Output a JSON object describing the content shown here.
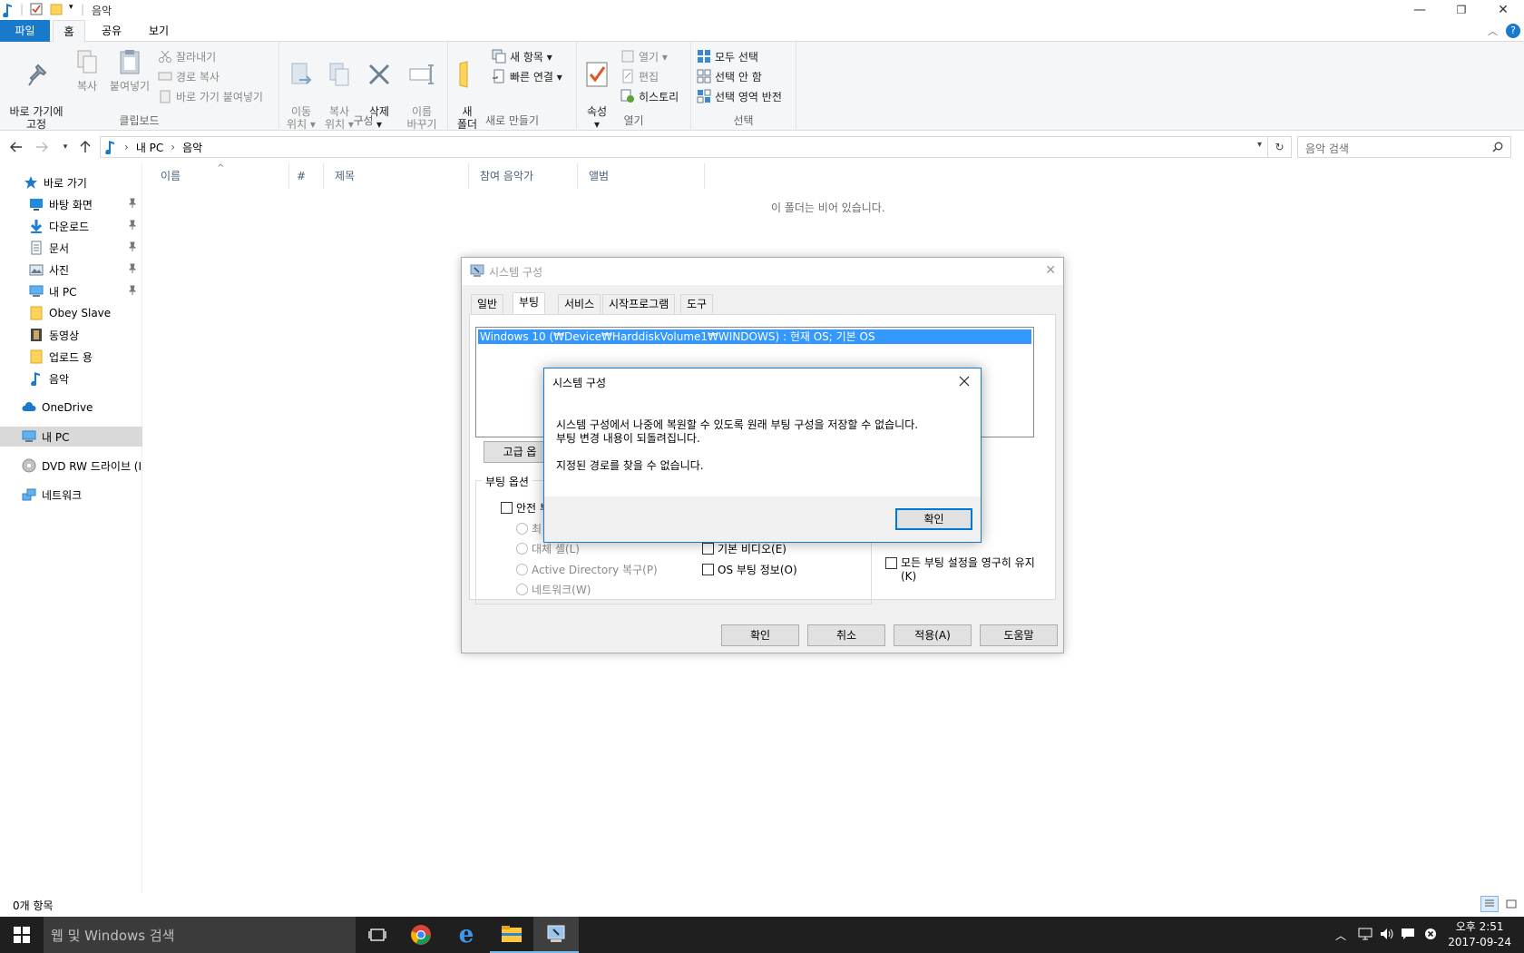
{
  "window": {
    "title": "음악",
    "minimize_glyph": "—",
    "restore_glyph": "❐",
    "close_glyph": "✕"
  },
  "ribbon_tabs": [
    "파일",
    "홈",
    "공유",
    "보기"
  ],
  "ribbon": {
    "clipboard": {
      "label": "클립보드",
      "pin": "바로 가기에\n고정",
      "copy": "복사",
      "paste": "붙여넣기",
      "cut": "잘라내기",
      "copy_path": "경로 복사",
      "paste_shortcut": "바로 가기 붙여넣기"
    },
    "organize": {
      "label": "구성",
      "move": "이동\n위치 ▾",
      "copyto": "복사\n위치 ▾",
      "delete": "삭제\n▾",
      "rename": "이름\n바꾸기"
    },
    "new": {
      "label": "새로 만들기",
      "new_folder": "새\n폴더",
      "new_item": "새 항목 ▾",
      "easy_access": "빠른 연결 ▾"
    },
    "open": {
      "label": "열기",
      "properties": "속성\n▾",
      "open": "열기 ▾",
      "edit": "편집",
      "history": "히스토리"
    },
    "select": {
      "label": "선택",
      "select_all": "모두 선택",
      "select_none": "선택 안 함",
      "invert": "선택 영역 반전"
    }
  },
  "address": {
    "crumbs": [
      "내 PC",
      "음악"
    ],
    "search_placeholder": "음악 검색"
  },
  "sidebar": {
    "quick_access": "바로 가기",
    "items": [
      {
        "label": "바탕 화면",
        "icon": "desktop-icon",
        "pinned": true
      },
      {
        "label": "다운로드",
        "icon": "download-icon",
        "pinned": true
      },
      {
        "label": "문서",
        "icon": "document-icon",
        "pinned": true
      },
      {
        "label": "사진",
        "icon": "picture-icon",
        "pinned": true
      },
      {
        "label": "내 PC",
        "icon": "computer-icon",
        "pinned": true
      },
      {
        "label": "Obey Slave",
        "icon": "folder-icon",
        "pinned": false
      },
      {
        "label": "동영상",
        "icon": "video-icon",
        "pinned": false
      },
      {
        "label": "업로드 용",
        "icon": "folder-icon",
        "pinned": false
      },
      {
        "label": "음악",
        "icon": "music-icon",
        "pinned": false
      }
    ],
    "onedrive": "OneDrive",
    "this_pc": "내 PC",
    "dvd": "DVD RW 드라이브 (I",
    "network": "네트워크"
  },
  "columns": [
    "이름",
    "#",
    "제목",
    "참여 음악가",
    "앨범"
  ],
  "empty_message": "이 폴더는 비어 있습니다.",
  "status": {
    "count": "0개 항목"
  },
  "taskbar": {
    "search_placeholder": "웹 및 Windows 검색",
    "time": "오후 2:51",
    "date": "2017-09-24"
  },
  "msconfig": {
    "title": "시스템 구성",
    "tabs": [
      "일반",
      "부팅",
      "서비스",
      "시작프로그램",
      "도구"
    ],
    "os_entry": "Windows 10 (₩Device₩HarddiskVolume1₩WINDOWS) : 현재 OS; 기본 OS",
    "advanced_button": "고급 옵",
    "boot_options_label": "부팅 옵션",
    "safe_boot": "안전 부",
    "minimal": "최",
    "alternate_shell": "대체 셸(L)",
    "active_directory": "Active Directory 복구(P)",
    "network": "네트워크(W)",
    "base_video": "기본 비디오(E)",
    "os_boot_info": "OS 부팅 정보(O)",
    "make_permanent": "모든 부팅 설정을 영구히 유지",
    "make_permanent_key": "(K)",
    "ok": "확인",
    "cancel": "취소",
    "apply": "적용(A)",
    "help": "도움말"
  },
  "message": {
    "title": "시스템 구성",
    "line1": "시스템 구성에서 나중에 복원할 수 있도록 원래 부팅 구성을 저장할 수 없습니다.",
    "line2": "부팅 변경 내용이 되돌려집니다.",
    "line3": "지정된 경로를 찾을 수 없습니다.",
    "ok": "확인"
  },
  "colors": {
    "accent": "#1979ca",
    "selection": "#3399ff",
    "taskbar": "#1f1f1f"
  }
}
